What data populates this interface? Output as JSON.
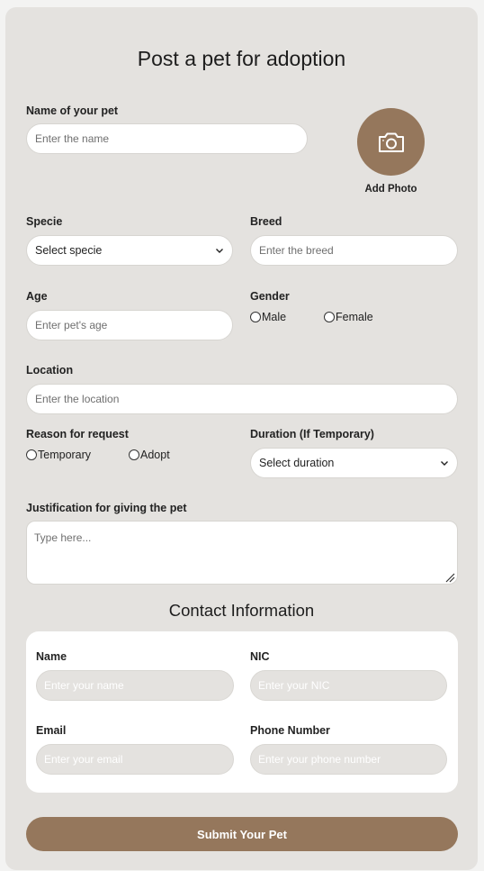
{
  "form": {
    "title": "Post a pet for adoption",
    "pet_name": {
      "label": "Name of your pet",
      "placeholder": "Enter the name"
    },
    "photo": {
      "label": "Add Photo",
      "icon": "camera-icon"
    },
    "specie": {
      "label": "Specie",
      "selected": "Select specie"
    },
    "breed": {
      "label": "Breed",
      "placeholder": "Enter the breed"
    },
    "age": {
      "label": "Age",
      "placeholder": "Enter pet's age"
    },
    "gender": {
      "label": "Gender",
      "options": [
        "Male",
        "Female"
      ]
    },
    "location": {
      "label": "Location",
      "placeholder": "Enter the location"
    },
    "reason": {
      "label": "Reason for request",
      "options": [
        "Temporary",
        "Adopt"
      ]
    },
    "duration": {
      "label": "Duration (If Temporary)",
      "selected": "Select duration"
    },
    "justification": {
      "label": "Justification for giving the pet",
      "placeholder": "Type here..."
    }
  },
  "contact": {
    "title": "Contact Information",
    "name": {
      "label": "Name",
      "placeholder": "Enter your name"
    },
    "nic": {
      "label": "NIC",
      "placeholder": "Enter your NIC"
    },
    "email": {
      "label": "Email",
      "placeholder": "Enter your email"
    },
    "phone": {
      "label": "Phone Number",
      "placeholder": "Enter your phone number"
    }
  },
  "submit_label": "Submit Your Pet",
  "colors": {
    "accent": "#95775c",
    "card": "#e4e2df",
    "page": "#f3f3f2"
  }
}
